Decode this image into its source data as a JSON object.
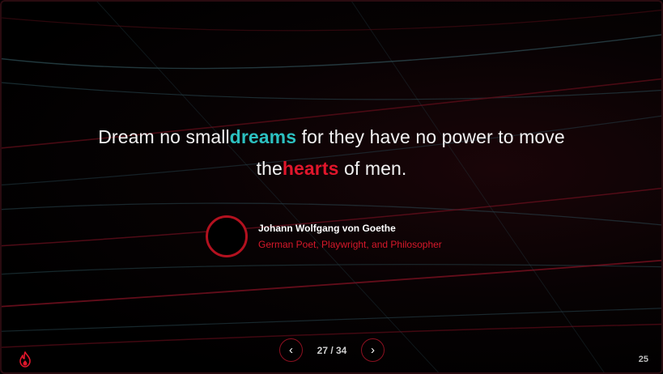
{
  "quote": {
    "part1": "Dream no small",
    "highlight1": "dreams",
    "part2": " for they have no power to move",
    "part3": "the",
    "highlight2": "hearts",
    "part4": " of men."
  },
  "author": {
    "name": "Johann Wolfgang von Goethe",
    "role": "German Poet, Playwright, and Philosopher"
  },
  "pager": {
    "prev_icon": "‹",
    "next_icon": "›",
    "counter": "27 / 34"
  },
  "slide_number": "25",
  "icons": {
    "logo": "flame-icon",
    "prev": "chevron-left-icon",
    "next": "chevron-right-icon"
  },
  "colors": {
    "teal_accent": "#2cc0c0",
    "red_accent": "#e0162b",
    "background": "#000000"
  }
}
